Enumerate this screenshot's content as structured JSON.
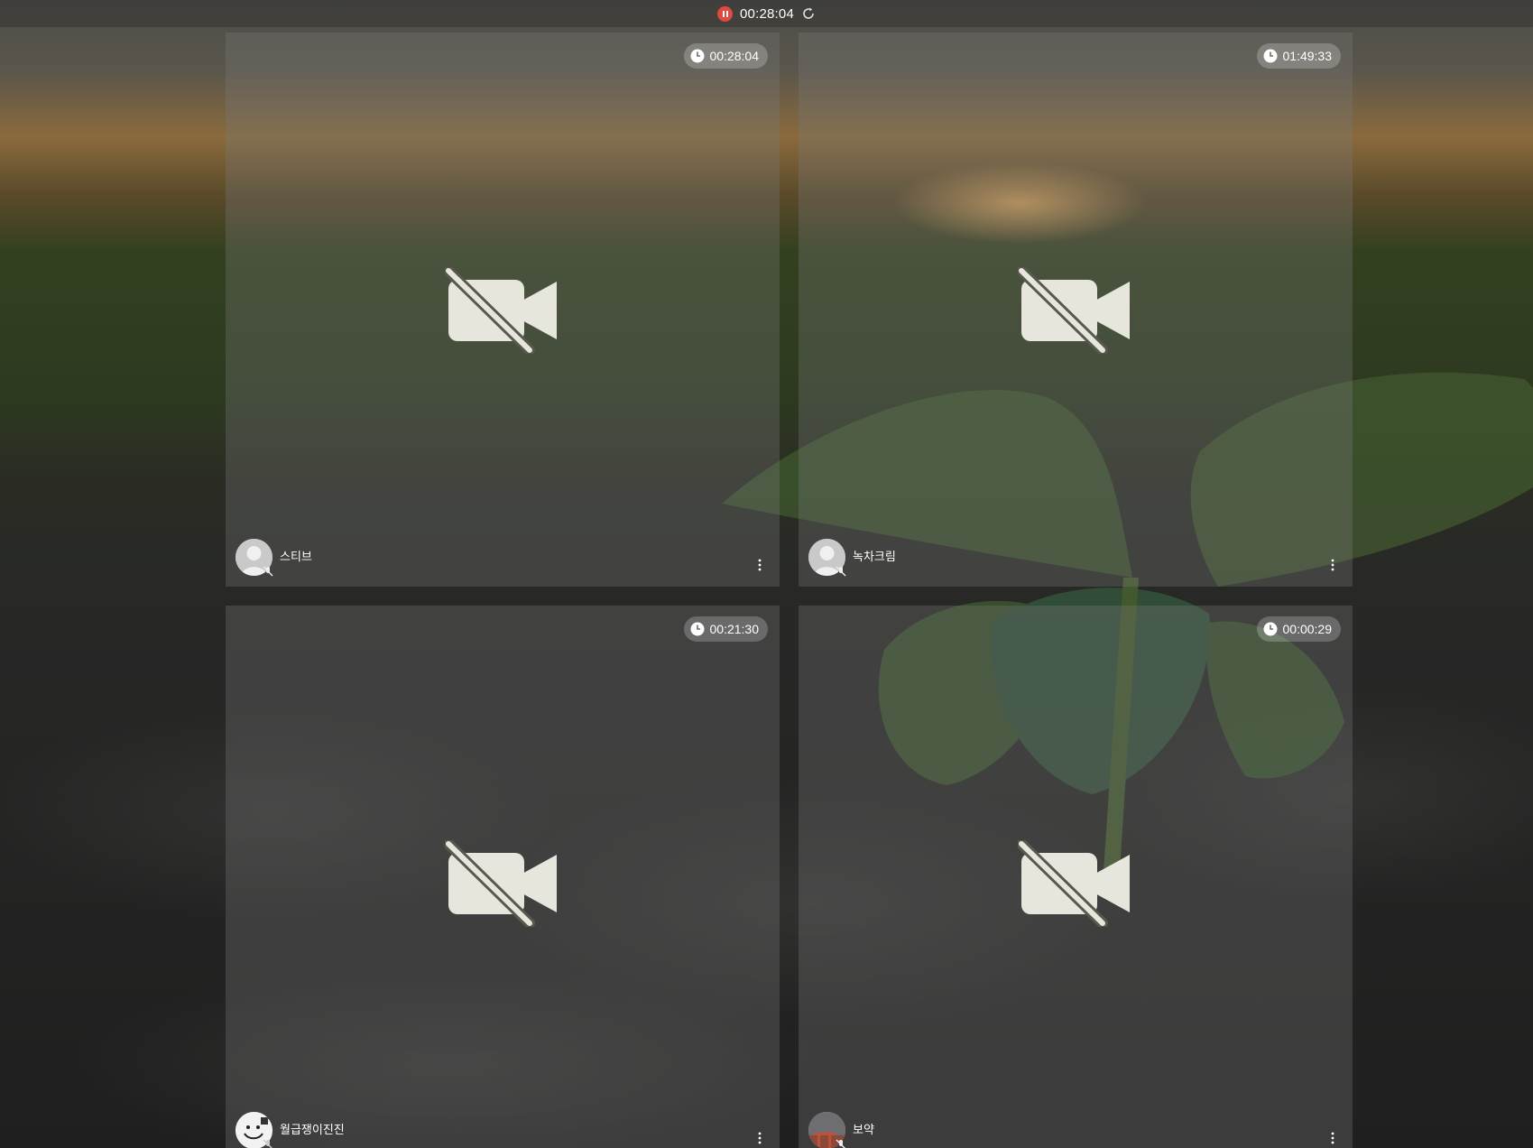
{
  "session": {
    "elapsed": "00:28:04"
  },
  "tiles": [
    {
      "name": "스티브",
      "duration": "00:28:04",
      "avatar": "default-avatar"
    },
    {
      "name": "녹차크림",
      "duration": "01:49:33",
      "avatar": "default-avatar"
    },
    {
      "name": "월급쟁이진진",
      "duration": "00:21:30",
      "avatar": "smiley-avatar"
    },
    {
      "name": "보약",
      "duration": "00:00:29",
      "avatar": "photo-avatar"
    }
  ],
  "colors": {
    "record": "#e2483d",
    "tile_overlay": "rgba(120,120,120,0.32)",
    "text": "#ffffff"
  }
}
